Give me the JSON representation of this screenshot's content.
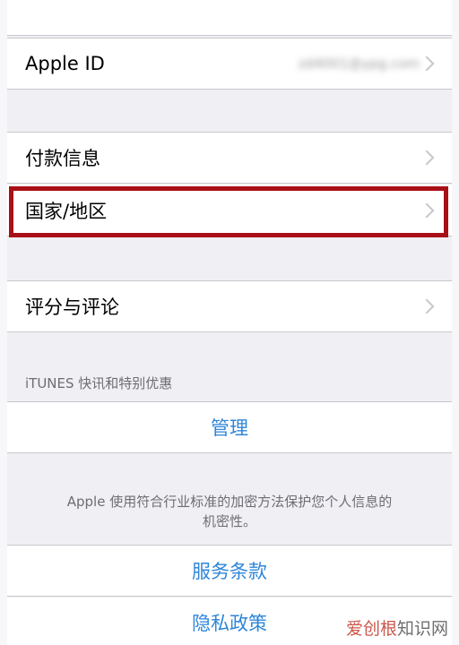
{
  "rows": {
    "apple_id": {
      "label": "Apple ID",
      "value": "zd4001@ypg.com"
    },
    "payment": {
      "label": "付款信息"
    },
    "country": {
      "label": "国家/地区"
    },
    "ratings": {
      "label": "评分与评论"
    }
  },
  "itunes_section": {
    "header": "iTUNES 快讯和特别优惠",
    "manage": "管理"
  },
  "privacy_note": {
    "line1": "Apple 使用符合行业标准的加密方法保护您个人信息的",
    "line2": "机密性。"
  },
  "links": {
    "terms": "服务条款",
    "privacy": "隐私政策"
  },
  "watermark": {
    "part1": "爱创根",
    "part2": "知识网"
  },
  "colors": {
    "accent": "#2f86d8",
    "highlight": "#a90f16",
    "background": "#efeff4"
  }
}
